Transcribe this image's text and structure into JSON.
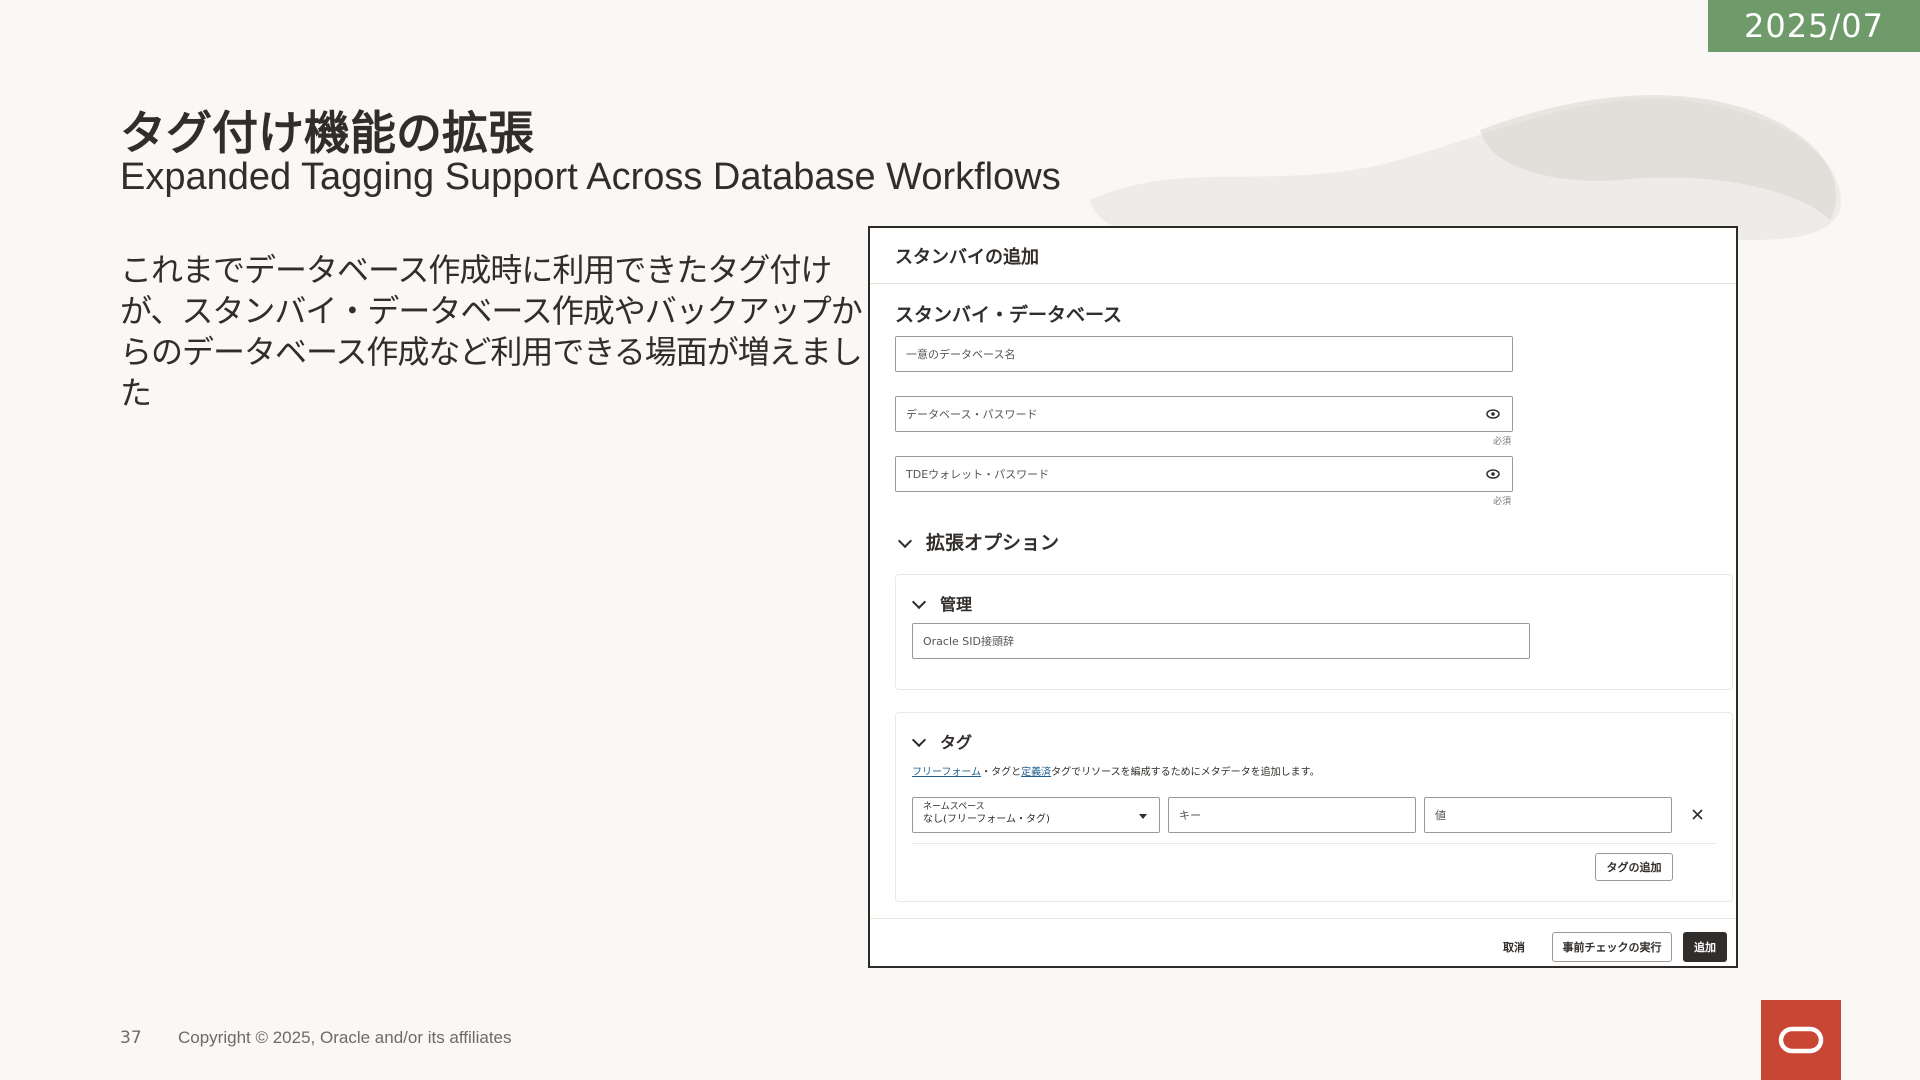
{
  "header": {
    "date": "2025/07",
    "title_ja": "タグ付け機能の拡張",
    "title_en": "Expanded Tagging Support Across Database Workflows"
  },
  "body": {
    "text": "これまでデータベース作成時に利用できたタグ付けが、スタンバイ・データベース作成やバックアップからのデータベース作成など利用できる場面が増えました"
  },
  "dialog": {
    "title": "スタンバイの追加",
    "standby_section": "スタンバイ・データベース",
    "db_name_placeholder": "一意のデータベース名",
    "db_password_placeholder": "データベース・パスワード",
    "tde_password_placeholder": "TDEウォレット・パスワード",
    "required": "必須",
    "advanced_options": "拡張オプション",
    "management": {
      "title": "管理",
      "sid_placeholder": "Oracle SID接頭辞"
    },
    "tags": {
      "title": "タグ",
      "help_link1": "フリーフォーム",
      "help_mid": "・タグと",
      "help_link2": "定義済",
      "help_end": "タグでリソースを編成するためにメタデータを追加します。",
      "namespace_label": "ネームスペース",
      "namespace_value": "なし(フリーフォーム・タグ)",
      "key_placeholder": "キー",
      "value_placeholder": "値",
      "add_tag": "タグの追加"
    },
    "footer": {
      "cancel": "取消",
      "precheck": "事前チェックの実行",
      "add": "追加"
    }
  },
  "footer": {
    "page": "37",
    "copyright": "Copyright © 2025, Oracle and/or its affiliates"
  },
  "colors": {
    "date_badge": "#6f9b6a",
    "oracle_red": "#c74634",
    "primary_button": "#312d2a"
  }
}
